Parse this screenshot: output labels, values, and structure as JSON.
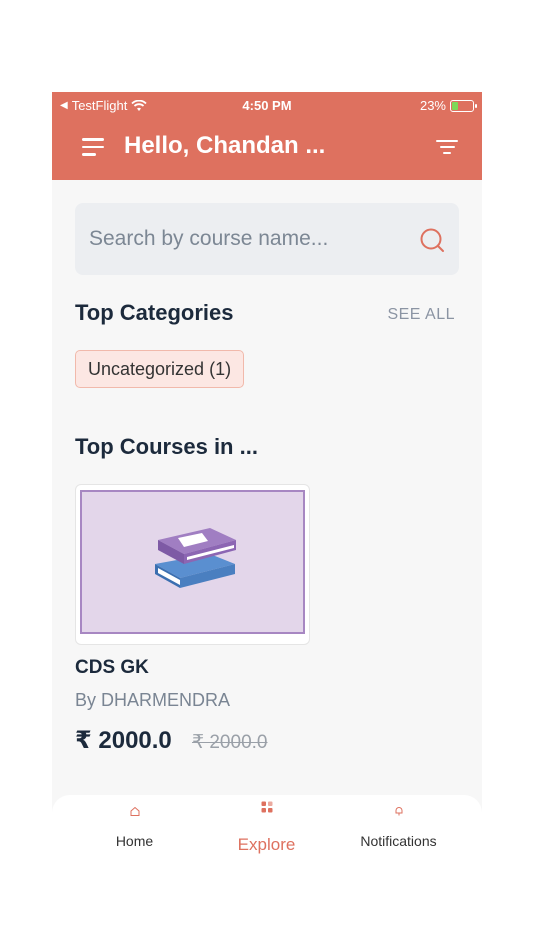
{
  "status_bar": {
    "carrier": "TestFlight",
    "time": "4:50 PM",
    "battery": "23%"
  },
  "header": {
    "title": "Hello, Chandan ..."
  },
  "search": {
    "placeholder": "Search by course name..."
  },
  "categories": {
    "title": "Top Categories",
    "see_all": "SEE ALL",
    "items": [
      {
        "label": "Uncategorized (1)"
      }
    ]
  },
  "courses": {
    "title": "Top Courses in ...",
    "items": [
      {
        "name": "CDS GK",
        "author": "By DHARMENDRA",
        "price": "₹ 2000.0",
        "original_price": "₹ 2000.0"
      }
    ]
  },
  "tabs": [
    {
      "label": "Home",
      "icon": "home-icon",
      "active": false
    },
    {
      "label": "Explore",
      "icon": "grid-icon",
      "active": true
    },
    {
      "label": "Notifications",
      "icon": "bell-icon",
      "active": false
    }
  ],
  "colors": {
    "accent": "#de715f",
    "chip_bg": "#fce7e3",
    "text_dark": "#1c2a3c"
  }
}
